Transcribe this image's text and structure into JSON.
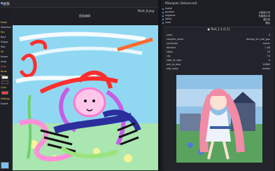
{
  "left_panel": {
    "title": "画板",
    "painter_tag": "Paint_6.png",
    "painter_title": "图画编辑",
    "tools": [
      "Mode",
      "Selection",
      "Pen",
      "Rect",
      "Ellipse",
      "Text",
      "Fill",
      "Eraser",
      "Undo",
      "Clear",
      "Brush Size",
      "Color",
      "Settings",
      "Export"
    ]
  },
  "right_panel": {
    "title": "KSampler (Advanced)",
    "rows": [
      {
        "label": "model",
        "value": ""
      },
      {
        "label": "positive",
        "value": "正面提示词"
      },
      {
        "label": "negative",
        "value": "负面提示词"
      },
      {
        "label": "latent",
        "value": "潜空间"
      },
      {
        "label": "seed",
        "value": "随机"
      },
      {
        "label": "steps",
        "value": "20"
      },
      {
        "label": "cfg",
        "value": "7"
      }
    ],
    "panel2_title": "● Text_1.1 (1.1)",
    "fields": [
      {
        "label": "seed",
        "value": "0"
      },
      {
        "label": "sampler_name",
        "value": "dpmpp_2m_sde_gpu"
      },
      {
        "label": "scheduler",
        "value": "karras"
      },
      {
        "label": "denoise",
        "value": "1.00"
      },
      {
        "label": "steps",
        "value": "20"
      },
      {
        "label": "cfg",
        "value": "7.0"
      },
      {
        "label": "start_at_step",
        "value": "0"
      },
      {
        "label": "end_at_step",
        "value": "10000"
      },
      {
        "label": "add_noise",
        "value": "enable"
      }
    ]
  },
  "colors": {
    "accent": "#6aa6ff",
    "bg_dark": "#1b1b1f",
    "panel": "#23242b",
    "canvas_sky": "#90d8f2"
  }
}
